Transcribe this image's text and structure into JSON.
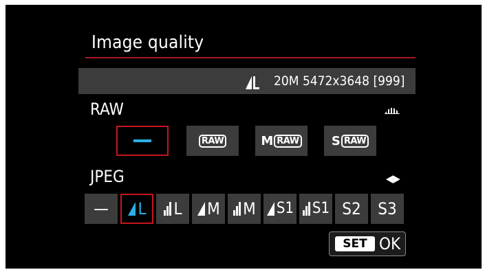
{
  "title": "Image quality",
  "info": {
    "size": "20M",
    "resolution": "5472x3648",
    "shots": "[999]",
    "quality_icon": "fine-large-icon"
  },
  "raw": {
    "label": "RAW",
    "options": [
      {
        "name": "none",
        "prefix": "",
        "box": ""
      },
      {
        "name": "raw",
        "prefix": "",
        "box": "RAW"
      },
      {
        "name": "mraw",
        "prefix": "M",
        "box": "RAW"
      },
      {
        "name": "sraw",
        "prefix": "S",
        "box": "RAW"
      }
    ],
    "selected": "none"
  },
  "jpeg": {
    "label": "JPEG",
    "arrows": "◀▶",
    "options": [
      {
        "name": "none",
        "text": "—",
        "icon": ""
      },
      {
        "name": "fine-L",
        "text": "L",
        "icon": "fine"
      },
      {
        "name": "normal-L",
        "text": "L",
        "icon": "normal"
      },
      {
        "name": "fine-M",
        "text": "M",
        "icon": "fine"
      },
      {
        "name": "normal-M",
        "text": "M",
        "icon": "normal"
      },
      {
        "name": "fine-S1",
        "text": "S1",
        "icon": "fine"
      },
      {
        "name": "normal-S1",
        "text": "S1",
        "icon": "normal"
      },
      {
        "name": "S2",
        "text": "S2",
        "icon": ""
      },
      {
        "name": "S3",
        "text": "S3",
        "icon": ""
      }
    ],
    "selected": "fine-L"
  },
  "footer": {
    "set": "SET",
    "ok": "OK"
  },
  "colors": {
    "accent": "#2ab0e4",
    "selection": "#c8161d",
    "button_bg": "#3c3c3c",
    "rule": "#a8181b"
  }
}
